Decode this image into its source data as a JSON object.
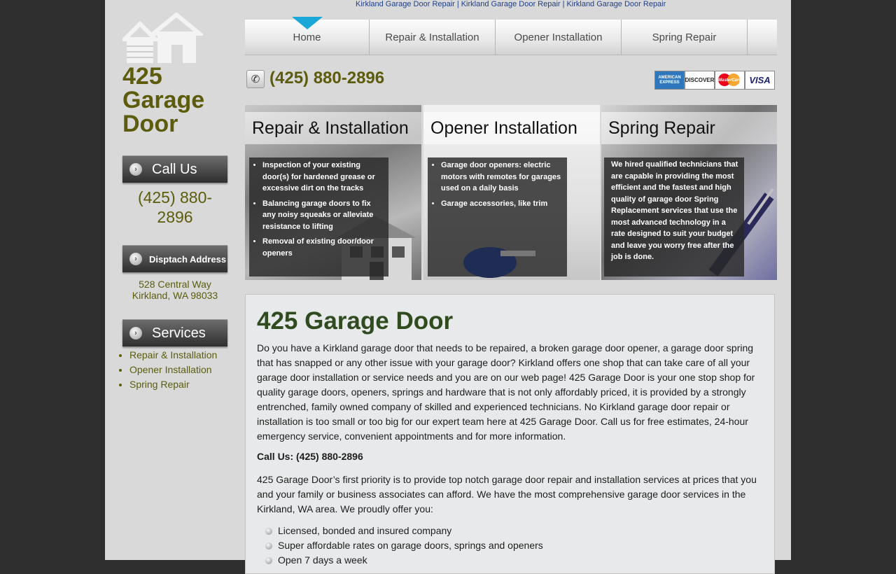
{
  "top_links": [
    "Kirkland Garage Door Repair",
    "Kirkland Garage Door Repair",
    "Kirkland Garage Door Repair"
  ],
  "logo": {
    "line1": "425",
    "line2": "Garage",
    "line3": "Door"
  },
  "nav": {
    "items": [
      "Home",
      "Repair & Installation",
      "Opener Installation",
      "Spring Repair"
    ],
    "active": "Home"
  },
  "phone_main": "(425) 880-2896",
  "cards": {
    "amex": "AMERICAN EXPRESS",
    "discover": "DISCOVER",
    "mastercard": "MasterCard",
    "visa": "VISA"
  },
  "sidebar": {
    "call_header": "Call Us",
    "call_line1": "(425) 880-",
    "call_line2": "2896",
    "address_header": "Disptach Address",
    "address_line1": "528 Central Way",
    "address_line2": "Kirkland, WA 98033",
    "services_header": "Services",
    "services": [
      "Repair & Installation",
      "Opener Installation",
      "Spring Repair"
    ]
  },
  "panels": [
    {
      "title": "Repair & Installation",
      "items": [
        "Inspection of your existing door(s) for hardened grease or excessive dirt on the tracks",
        "Balancing garage doors to fix any noisy squeaks or alleviate resistance to lifting",
        "Removal of existing door/door openers"
      ]
    },
    {
      "title": "Opener Installation",
      "items": [
        "Garage door openers: electric motors with remotes for garages used on a daily basis",
        "Garage accessories, like trim"
      ]
    },
    {
      "title": "Spring Repair",
      "text": "We hired qualified technicians that are capable in providing the most efficient and the fastest and high quality of garage door Spring Replacement services that use the most advanced technology in a rate designed to suit your budget and leave you worry free after the job is done."
    }
  ],
  "content": {
    "heading": "425 Garage Door",
    "p1": "Do you have a Kirkland garage door that needs to be repaired, a broken garage door opener, a garage door spring that has snapped or any other issue with your garage door? Kirkland offers one shop that can take care of all your garage door installation or service needs and you are on our web page! 425 Garage Door is your one stop shop for quality garage doors, openers, springs and hardware that is not only affordably priced, it is provided by a strongly entrenched, family owned company of skilled and experienced technicians. No Kirkland garage door repair or installation is too small or too big for our expert team here at 425 Garage Door. Call us for free estimates, 24-hour emergency service, convenient appointments and for more information.",
    "call_us": "Call Us: (425) 880-2896",
    "p2": "425 Garage Door’s first priority is to provide top notch garage door repair and installation services at prices that you and your family or business associates can afford. We have the most comprehensive garage door services in the Kirkland, WA area. We proudly offer you:",
    "offers": [
      "Licensed, bonded and insured company",
      "Super affordable rates on garage doors, springs and openers",
      "Open 7 days a week"
    ]
  }
}
